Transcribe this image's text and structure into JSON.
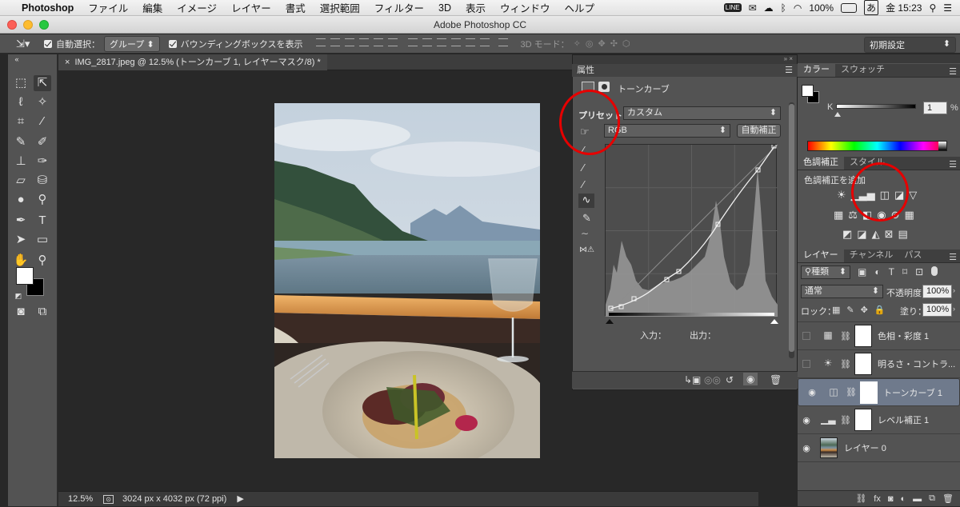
{
  "menubar": {
    "app": "Photoshop",
    "items": [
      "ファイル",
      "編集",
      "イメージ",
      "レイヤー",
      "書式",
      "選択範囲",
      "フィルター",
      "3D",
      "表示",
      "ウィンドウ",
      "ヘルプ"
    ],
    "battery": "100%",
    "input_method": "あ",
    "clock": "金 15:23"
  },
  "window": {
    "title": "Adobe Photoshop CC"
  },
  "options_bar": {
    "auto_select_label": "自動選択：",
    "auto_select_value": "グループ",
    "bounding_box_label": "バウンディングボックスを表示",
    "mode_3d_label": "3D モード：",
    "workspace": "初期設定"
  },
  "document": {
    "tab_title": "IMG_2817.jpeg @ 12.5% (トーンカーブ 1, レイヤーマスク/8) *",
    "zoom": "12.5%",
    "info": "3024 px x 4032 px (72 ppi)"
  },
  "properties": {
    "panel_title": "属性",
    "adjustment_name": "トーンカーブ",
    "preset_label": "プリセット：",
    "preset_value": "カスタム",
    "channel_value": "RGB",
    "auto_button": "自動補正",
    "input_label": "入力：",
    "output_label": "出力："
  },
  "color_panel": {
    "tabs": [
      "カラー",
      "スウォッチ"
    ],
    "channel_label": "K",
    "value": "1",
    "unit": "%"
  },
  "adjustments_panel": {
    "tabs": [
      "色調補正",
      "スタイル"
    ],
    "add_label": "色調補正を追加"
  },
  "layers_panel": {
    "tabs": [
      "レイヤー",
      "チャンネル",
      "パス"
    ],
    "filter_kind": "種類",
    "blend_mode": "通常",
    "opacity_label": "不透明度：",
    "opacity_value": "100%",
    "lock_label": "ロック：",
    "fill_label": "塗り：",
    "fill_value": "100%",
    "layers": [
      {
        "name": "色相・彩度 1",
        "visible": false,
        "selected": false
      },
      {
        "name": "明るさ・コントラ...",
        "visible": false,
        "selected": false
      },
      {
        "name": "トーンカーブ 1",
        "visible": true,
        "selected": true
      },
      {
        "name": "レベル補正 1",
        "visible": true,
        "selected": false
      },
      {
        "name": "レイヤー 0",
        "visible": true,
        "selected": false
      }
    ]
  },
  "annotations": {
    "highlight_color": "#e60000"
  }
}
